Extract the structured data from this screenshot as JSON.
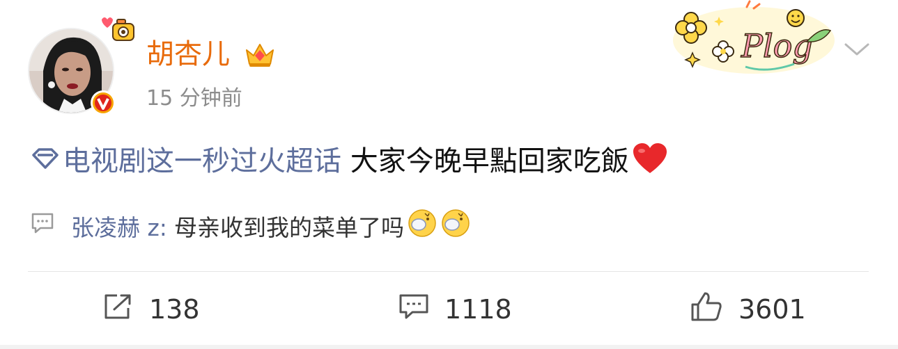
{
  "post": {
    "author": "胡杏儿",
    "timestamp": "15 分钟前",
    "topic": "电视剧这一秒过火超话",
    "body": " 大家今晚早點回家吃飯",
    "badge_decoration": "Plog"
  },
  "comment_preview": {
    "author": "张凌赫 z:",
    "text": "母亲收到我的菜单了吗"
  },
  "actions": {
    "repost_count": "138",
    "comment_count": "1118",
    "like_count": "3601"
  },
  "colors": {
    "username": "#e86b0c",
    "link": "#5d6e9c",
    "muted": "#8c8c8c"
  },
  "icons": [
    "verified-v-icon",
    "crown-icon",
    "dropdown-chevron-icon",
    "topic-diamond-icon",
    "heart-icon",
    "comment-icon",
    "emoji-icon",
    "repost-icon",
    "like-icon"
  ]
}
